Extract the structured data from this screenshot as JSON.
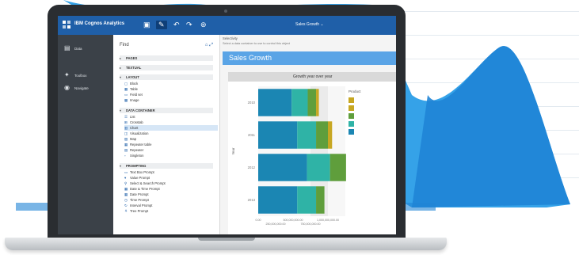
{
  "app": {
    "brand": "IBM Cognos Analytics",
    "report_title": "Sales Growth",
    "report_title_caret": "⌄"
  },
  "toolbar_icons": [
    "toolbox-icon",
    "pen-icon",
    "undo-icon",
    "redo-icon",
    "more-icon"
  ],
  "left_nav": [
    {
      "label": "Data",
      "icon": "data-icon"
    },
    {
      "label": "Toolbox",
      "icon": "toolbox-icon"
    },
    {
      "label": "Navigate",
      "icon": "navigate-icon"
    }
  ],
  "toolbox": {
    "find_label": "Find",
    "sections": {
      "pages": "PAGES",
      "textual": "TEXTUAL",
      "layout": "LAYOUT",
      "data_container": "DATA CONTAINER",
      "prompting": "PROMPTING"
    },
    "layout_items": [
      "Block",
      "Table",
      "Field set",
      "Image"
    ],
    "data_items": [
      "List",
      "Crosstab",
      "Chart",
      "Visualization",
      "Map",
      "Repeater table",
      "Repeater",
      "Singleton"
    ],
    "prompting_items": [
      "Text Box Prompt",
      "Value Prompt",
      "Select & Search Prompt",
      "Date & Time Prompt",
      "Date Prompt",
      "Time Prompt",
      "Interval Prompt",
      "Tree Prompt"
    ]
  },
  "canvas": {
    "selectivity_label": "Selectivity",
    "hint": "Select a data container to use to control this object",
    "banner_title": "Sales Growth"
  },
  "chart_data": {
    "type": "bar",
    "orientation": "horizontal",
    "stacked": true,
    "title": "Growth year over year",
    "ylabel": "Year",
    "categories": [
      "2010",
      "2011",
      "2012",
      "2013"
    ],
    "series": [
      {
        "color": "#1b86b3",
        "values": [
          480000000,
          560000000,
          700000000,
          560000000
        ]
      },
      {
        "color": "#2fb3a6",
        "values": [
          230000000,
          270000000,
          330000000,
          270000000
        ]
      },
      {
        "color": "#5f9e3c",
        "values": [
          120000000,
          170000000,
          230000000,
          120000000
        ]
      },
      {
        "color": "#c7a722",
        "values": [
          40000000,
          60000000,
          0,
          0
        ]
      }
    ],
    "xlim": [
      0,
      1250000000
    ],
    "xticks": [
      "0.00",
      "250,000,000.00",
      "500,000,000.00",
      "750,000,000.00",
      "1,000,000,000.00"
    ],
    "legend_title": "Product",
    "legend_position": "right",
    "grid": false
  }
}
